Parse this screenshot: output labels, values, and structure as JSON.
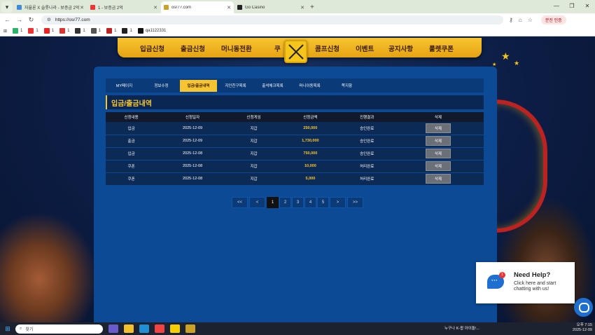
{
  "browser": {
    "tabs": [
      {
        "title": "자율론 X 슬롯나라 - 보증금 2억",
        "fav_color": "#3d8bd9",
        "active": false
      },
      {
        "title": "1 - 보증금 2억",
        "fav_color": "#e33",
        "active": false
      },
      {
        "title": "osr77.com",
        "fav_color": "#c9a227",
        "active": true
      },
      {
        "title": "Go Casino",
        "fav_color": "#222",
        "active": false
      }
    ],
    "url": "https://osr77.com",
    "profile_label": "분진 인증",
    "bookmarks": [
      {
        "label": "1",
        "color": "#2db36b"
      },
      {
        "label": "1",
        "color": "#e33"
      },
      {
        "label": "1",
        "color": "#e22"
      },
      {
        "label": "1",
        "color": "#d33"
      },
      {
        "label": "1",
        "color": "#333"
      },
      {
        "label": "1",
        "color": "#555"
      },
      {
        "label": "1",
        "color": "#b22"
      },
      {
        "label": "1",
        "color": "#222"
      },
      {
        "label": "qa1122331",
        "color": "#111"
      }
    ]
  },
  "site": {
    "top_nav": [
      "입금신청",
      "출금신청",
      "머니동전환",
      "쿠",
      "콤프신청",
      "이벤트",
      "공지사항",
      "룰렛쿠폰"
    ],
    "sub_tabs": [
      "MY페이지",
      "정보수정",
      "입금/출금내역",
      "지인친구목록",
      "출석체크목록",
      "머니이동목록",
      "쪽지함"
    ],
    "active_sub_tab": 2,
    "section_title": "입금/출금내역",
    "table": {
      "headers": [
        "신청내용",
        "신청일자",
        "신청게임",
        "신청금액",
        "진행결과",
        "삭제"
      ],
      "rows": [
        {
          "type": "입금",
          "date": "2025-12-09",
          "game": "지갑",
          "amount": "250,000",
          "status": "승인완료",
          "action": "삭제"
        },
        {
          "type": "출금",
          "date": "2025-12-09",
          "game": "지갑",
          "amount": "1,730,000",
          "status": "승인완료",
          "action": "삭제"
        },
        {
          "type": "입금",
          "date": "2025-12-08",
          "game": "지갑",
          "amount": "750,000",
          "status": "승인완료",
          "action": "삭제"
        },
        {
          "type": "쿠폰",
          "date": "2025-12-08",
          "game": "지갑",
          "amount": "10,000",
          "status": "처리완료",
          "action": "삭제"
        },
        {
          "type": "쿠폰",
          "date": "2025-12-08",
          "game": "지갑",
          "amount": "5,000",
          "status": "처리완료",
          "action": "삭제"
        }
      ]
    },
    "pagination": {
      "first": "<<",
      "prev": "<",
      "pages": [
        "1",
        "2",
        "3",
        "4",
        "5"
      ],
      "current": "1",
      "next": ">",
      "last": ">>"
    },
    "help_widget": {
      "title": "Need Help?",
      "text": "Click here and start chatting with us!",
      "badge": "1"
    }
  },
  "taskbar": {
    "search_placeholder": "찾기",
    "notification": "누구나 K-팝 아이돌!...",
    "time": "오후 7:15",
    "date": "2025-12-09"
  },
  "colors": {
    "accent": "#f7c531",
    "panel": "#0c4a96",
    "chat": "#1e6fd0"
  }
}
